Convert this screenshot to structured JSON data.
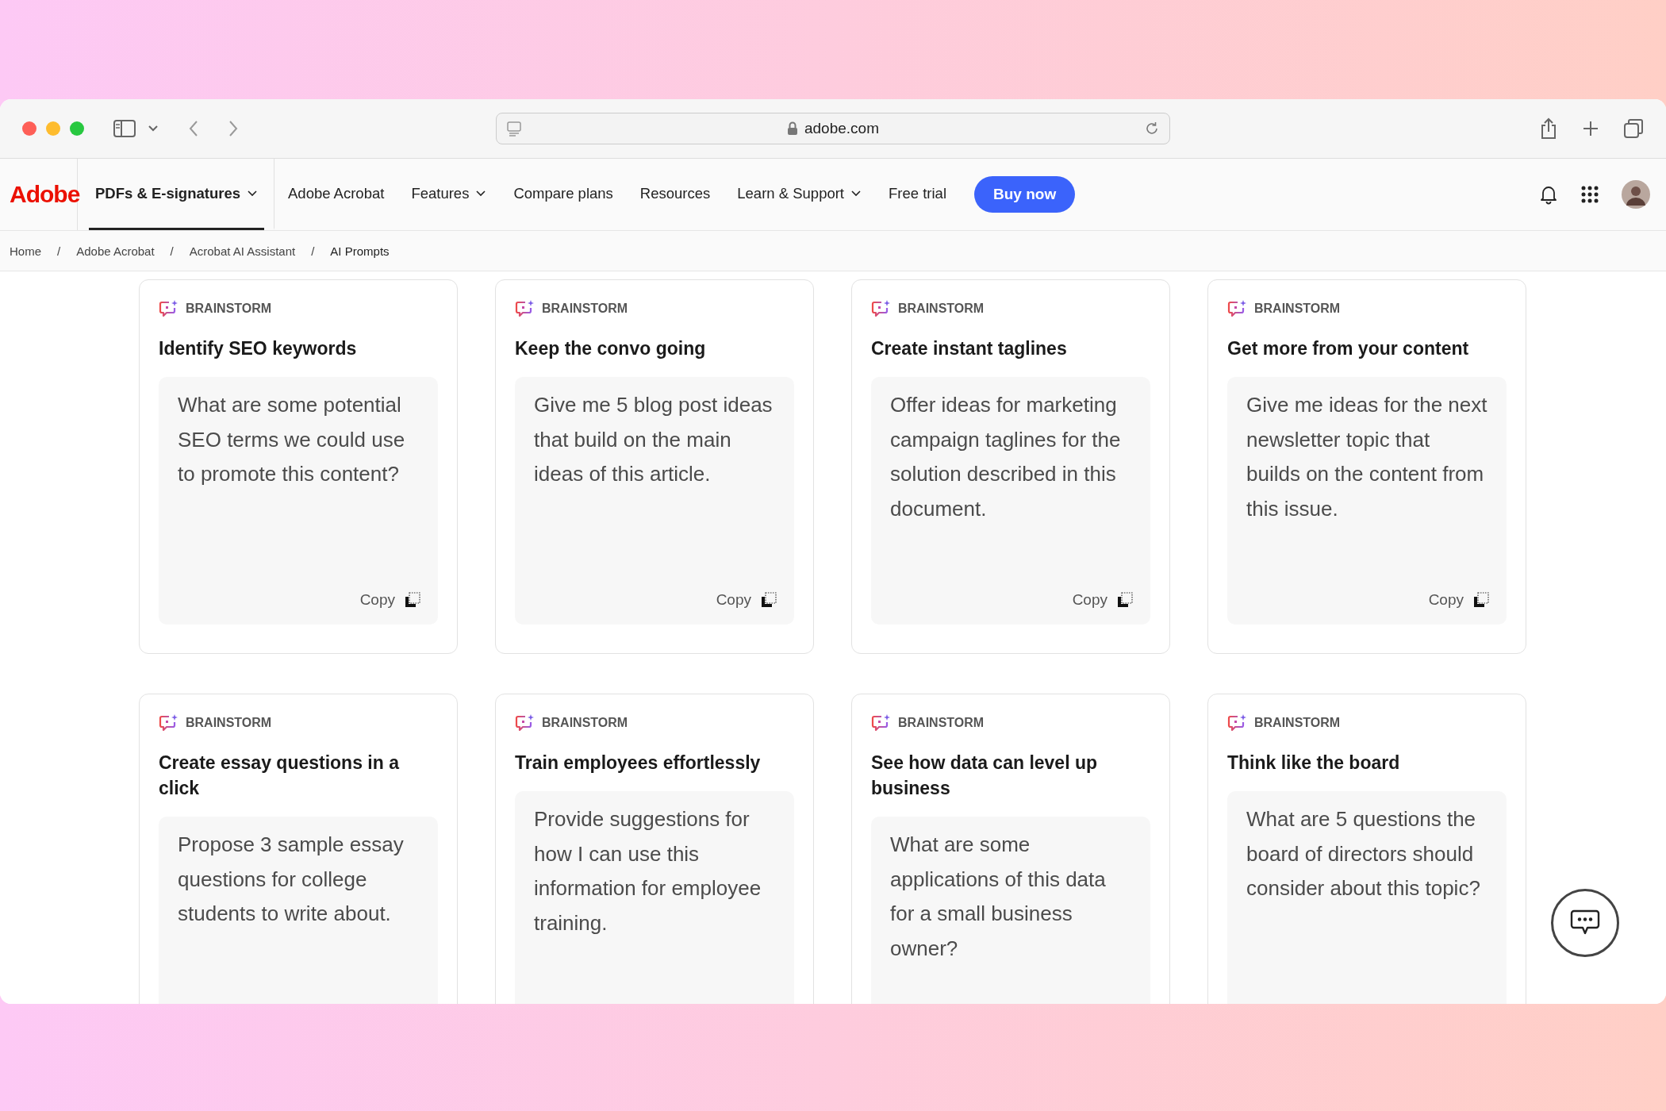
{
  "browser": {
    "url": "adobe.com"
  },
  "nav": {
    "logo": "Adobe",
    "items": [
      {
        "label": "PDFs & E-signatures",
        "selected": true,
        "dropdown": true
      },
      {
        "label": "Adobe Acrobat",
        "selected": false,
        "dropdown": false
      },
      {
        "label": "Features",
        "selected": false,
        "dropdown": true
      },
      {
        "label": "Compare plans",
        "selected": false,
        "dropdown": false
      },
      {
        "label": "Resources",
        "selected": false,
        "dropdown": false
      },
      {
        "label": "Learn & Support",
        "selected": false,
        "dropdown": true
      },
      {
        "label": "Free trial",
        "selected": false,
        "dropdown": false
      }
    ],
    "cta": "Buy now"
  },
  "breadcrumb": {
    "separator": "/",
    "items": [
      "Home",
      "Adobe Acrobat",
      "Acrobat AI Assistant",
      "AI Prompts"
    ]
  },
  "cards": [
    {
      "tag": "BRAINSTORM",
      "title": "Identify SEO keywords",
      "prompt": "What are some potential SEO terms we could use to promote this content?",
      "copy": "Copy"
    },
    {
      "tag": "BRAINSTORM",
      "title": "Keep the convo going",
      "prompt": "Give me 5 blog post ideas that build on the main ideas of this article.",
      "copy": "Copy"
    },
    {
      "tag": "BRAINSTORM",
      "title": "Create instant taglines",
      "prompt": "Offer ideas for marketing campaign taglines for the solution described in this document.",
      "copy": "Copy"
    },
    {
      "tag": "BRAINSTORM",
      "title": "Get more from your content",
      "prompt": "Give me ideas for the next newsletter topic that builds on the content from this issue.",
      "copy": "Copy"
    },
    {
      "tag": "BRAINSTORM",
      "title": "Create essay questions in a click",
      "prompt": "Propose 3 sample essay questions for college students to write about."
    },
    {
      "tag": "BRAINSTORM",
      "title": "Train employees effortlessly",
      "prompt": "Provide suggestions for how I can use this information for employee training."
    },
    {
      "tag": "BRAINSTORM",
      "title": "See how data can level up business",
      "prompt": "What are some applications of this data for a small business owner?"
    },
    {
      "tag": "BRAINSTORM",
      "title": "Think like the board",
      "prompt": "What are 5 questions the board of directors should consider about this topic?"
    }
  ]
}
